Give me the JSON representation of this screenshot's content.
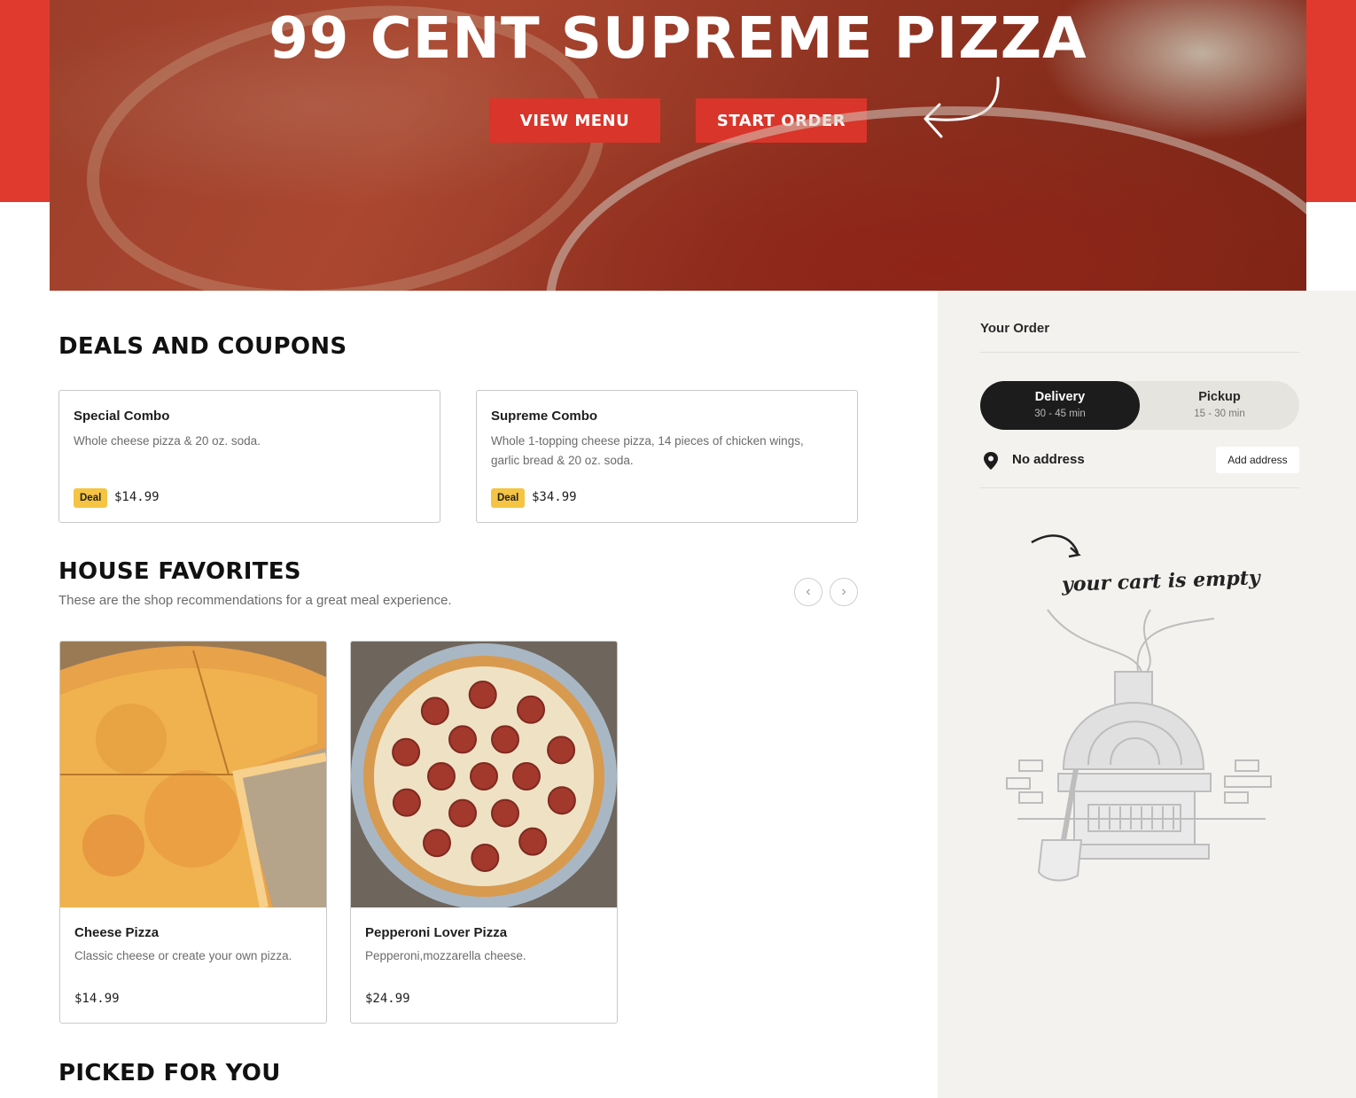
{
  "hero": {
    "title": "99 CENT SUPREME PIZZA",
    "view_menu_label": "VIEW MENU",
    "start_order_label": "START ORDER"
  },
  "deals": {
    "title": "DEALS AND COUPONS",
    "items": [
      {
        "name": "Special Combo",
        "description": "Whole cheese pizza & 20 oz. soda.",
        "badge": "Deal",
        "price": "$14.99"
      },
      {
        "name": "Supreme Combo",
        "description": "Whole 1-topping cheese pizza, 14 pieces of chicken wings, garlic bread & 20 oz. soda.",
        "badge": "Deal",
        "price": "$34.99"
      }
    ]
  },
  "favorites": {
    "title": "HOUSE FAVORITES",
    "subtitle": "These are the shop recommendations for a great meal experience.",
    "items": [
      {
        "name": "Cheese Pizza",
        "description": "Classic cheese or create your own pizza.",
        "price": "$14.99"
      },
      {
        "name": "Pepperoni Lover Pizza",
        "description": "Pepperoni,mozzarella cheese.",
        "price": "$24.99"
      }
    ]
  },
  "picked": {
    "title": "PICKED FOR YOU"
  },
  "order": {
    "title": "Your Order",
    "delivery": {
      "label": "Delivery",
      "time": "30 - 45 min"
    },
    "pickup": {
      "label": "Pickup",
      "time": "15 - 30 min"
    },
    "address_text": "No address",
    "add_address_label": "Add address",
    "empty_text": "your cart is empty"
  },
  "colors": {
    "brand_red": "#e03a2f",
    "deal_badge": "#f6c443",
    "sidebar_bg": "#f3f2ef",
    "toggle_active": "#1c1c1c"
  },
  "icons": [
    "curved-arrow-icon",
    "chevron-left-icon",
    "chevron-right-icon",
    "location-pin-icon",
    "pizza-oven-illustration"
  ]
}
